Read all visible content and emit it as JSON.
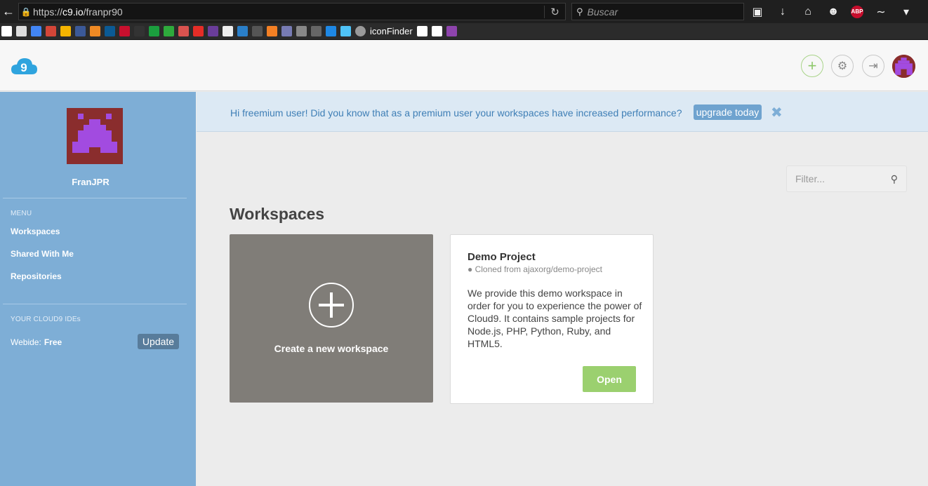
{
  "browser": {
    "url_prefix": "https://",
    "url_host": "c9.io",
    "url_path": "/franpr90",
    "search_placeholder": "Buscar",
    "abp_label": "ABP",
    "bookmark_label": "iconFinder"
  },
  "header": {
    "logo_icon": "cloud9-logo-icon",
    "plus_icon": "+",
    "gear_icon": "⚙",
    "signout_icon": "⇥"
  },
  "sidebar": {
    "username": "FranJPR",
    "menu_heading": "MENU",
    "menu_items": [
      "Workspaces",
      "Shared With Me",
      "Repositories"
    ],
    "ides_heading": "YOUR CLOUD9 IDEs",
    "webide_label": "Webide:",
    "webide_plan": "Free",
    "update_label": "Update"
  },
  "banner": {
    "text": "Hi freemium user! Did you know that as a premium user your workspaces have increased performance?",
    "upgrade_label": "upgrade today",
    "close_icon": "✖"
  },
  "main": {
    "filter_placeholder": "Filter...",
    "title": "Workspaces",
    "create_label": "Create a new workspace",
    "demo": {
      "title": "Demo Project",
      "clone_text": "Cloned from ajaxorg/demo-project",
      "description": "We provide this demo workspace in order for you to experience the power of Cloud9. It contains sample projects for Node.js, PHP, Python, Ruby, and HTML5.",
      "open_label": "Open"
    }
  },
  "colors": {
    "sidebar": "#7eaed6",
    "banner": "#dce9f4",
    "open": "#9bd06f",
    "avatar_bg": "#8a2d2d",
    "avatar_fg": "#a24be0"
  }
}
